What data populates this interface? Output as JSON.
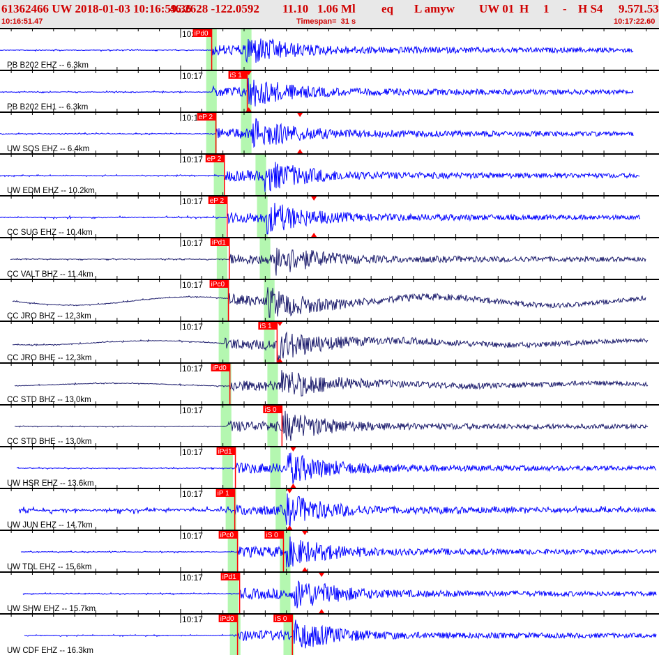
{
  "header": {
    "fields": [
      "61362466 UW 2018-01-03 10:16:59.36",
      "46.2628 -122.0592",
      "11.10",
      "1.06 Ml",
      "eq",
      "L amyw",
      "UW 01",
      "H",
      "1",
      "-",
      "H S4",
      "9.57",
      "1.53"
    ],
    "start_time": "10:16:51.47",
    "timespan": "Timespan=  31 s",
    "end_time": "10:17:22.60"
  },
  "timescale": {
    "total_seconds": 31.13,
    "minute_mark_s": 8.53,
    "minute_label": "10:17"
  },
  "colors": {
    "pick": "#ff0000",
    "band": "#b4f7b0",
    "blue": "#0000ff",
    "navy": "#1c1c6c",
    "header_text": "#d00000"
  },
  "traces": [
    {
      "label": "PB B202 EHZ -- 6.3km",
      "color": "blue",
      "span": [
        0,
        29.9
      ],
      "noise": 1,
      "picks": [
        {
          "label": "iPd0",
          "t": 10.0,
          "phase": "P"
        }
      ],
      "s_onset": 11.6,
      "bands": [
        9.74,
        11.38
      ],
      "amp_marker": null
    },
    {
      "label": "PB B202 EH1 -- 6.3km",
      "color": "blue",
      "span": [
        0,
        29.9
      ],
      "noise": 1,
      "picks": [
        {
          "label": "iS 1",
          "t": 11.68,
          "phase": "S"
        }
      ],
      "s_onset": 11.68,
      "bands": [
        9.74,
        11.38
      ],
      "amp_marker": 11.75
    },
    {
      "label": "UW SQS EHZ -- 6.4km",
      "color": "blue",
      "span": [
        0,
        29.9
      ],
      "noise": 1,
      "picks": [
        {
          "label": "eP 2",
          "t": 10.2,
          "phase": "P"
        }
      ],
      "s_onset": 11.9,
      "bands": [
        9.74,
        11.38
      ],
      "amp_marker": 14.17
    },
    {
      "label": "UW EDM EHZ -- 10.2km",
      "color": "blue",
      "span": [
        0,
        30.2
      ],
      "noise": 1,
      "picks": [
        {
          "label": "eP 2",
          "t": 10.6,
          "phase": "P"
        }
      ],
      "s_onset": 12.5,
      "bands": [
        10.1,
        12.07
      ],
      "amp_marker": null
    },
    {
      "label": "CC SUG EHZ -- 10.4km",
      "color": "blue",
      "span": [
        0,
        30.25
      ],
      "noise": 1.5,
      "picks": [
        {
          "label": "eP 2",
          "t": 10.73,
          "phase": "P"
        }
      ],
      "s_onset": 12.6,
      "bands": [
        10.17,
        12.14
      ],
      "amp_marker": 14.83
    },
    {
      "label": "CC VALT BHZ -- 11.4km",
      "color": "navy",
      "span": [
        0.5,
        30.5
      ],
      "noise": 1,
      "picks": [
        {
          "label": "iPd1",
          "t": 10.83,
          "phase": "P"
        }
      ],
      "s_onset": 13.0,
      "bands": [
        10.24,
        12.27
      ],
      "amp_marker": null
    },
    {
      "label": "CC JRO BHZ -- 12.3km",
      "color": "navy",
      "span": [
        0.6,
        30.5
      ],
      "noise": 1,
      "swell": 6,
      "picks": [
        {
          "label": "iPc0",
          "t": 10.79,
          "phase": "P"
        }
      ],
      "s_onset": 12.6,
      "bands": [
        10.33,
        12.47
      ],
      "amp_marker": null
    },
    {
      "label": "CC JRO BHE -- 12.3km",
      "color": "navy",
      "span": [
        0.6,
        30.6
      ],
      "noise": 1,
      "swell": 3,
      "picks": [
        {
          "label": "iS 1",
          "t": 13.09,
          "phase": "S"
        }
      ],
      "s_onset": 13.1,
      "bands": [
        10.33,
        12.47
      ],
      "amp_marker": 13.22
    },
    {
      "label": "CC STD BHZ -- 13.0km",
      "color": "navy",
      "span": [
        0.7,
        30.6
      ],
      "noise": 1,
      "swell": 2,
      "picks": [
        {
          "label": "iPd0",
          "t": 10.86,
          "phase": "P"
        }
      ],
      "s_onset": 13.3,
      "bands": [
        10.43,
        12.63
      ],
      "amp_marker": null
    },
    {
      "label": "CC STD BHE -- 13.0km",
      "color": "navy",
      "span": [
        0.7,
        30.6
      ],
      "noise": 0.7,
      "picks": [
        {
          "label": "iS 0",
          "t": 13.32,
          "phase": "S"
        }
      ],
      "s_onset": 13.32,
      "bands": [
        10.43,
        12.63
      ],
      "amp_marker": null
    },
    {
      "label": "UW HSR EHZ -- 13.6km",
      "color": "blue",
      "span": [
        0.8,
        31.0
      ],
      "noise": 1,
      "picks": [
        {
          "label": "iPd1",
          "t": 11.12,
          "phase": "P"
        }
      ],
      "s_onset": 13.6,
      "bands": [
        10.5,
        12.76
      ],
      "amp_marker": 13.85
    },
    {
      "label": "UW JUN EHZ -- 14.7km",
      "color": "blue",
      "span": [
        0.9,
        31.0
      ],
      "noise": 4,
      "picks": [
        {
          "label": "iP 1",
          "t": 11.09,
          "phase": "P"
        }
      ],
      "s_onset": 13.5,
      "bands": [
        10.66,
        13.02
      ],
      "amp_marker": 13.68
    },
    {
      "label": "UW TDL EHZ -- 15.6km",
      "color": "blue",
      "span": [
        1.0,
        31.0
      ],
      "noise": 1,
      "picks": [
        {
          "label": "iPc0",
          "t": 11.22,
          "phase": "P"
        },
        {
          "label": "iS 0",
          "t": 13.39,
          "phase": "S"
        }
      ],
      "s_onset": 13.39,
      "bands": [
        10.76,
        13.22
      ],
      "amp_marker": 14.4
    },
    {
      "label": "UW SHW EHZ -- 15.7km",
      "color": "blue",
      "span": [
        1.1,
        31.0
      ],
      "noise": 1,
      "picks": [
        {
          "label": "iPd1",
          "t": 11.32,
          "phase": "P"
        }
      ],
      "s_onset": 13.9,
      "bands": [
        10.76,
        13.22
      ],
      "amp_marker": 15.19
    },
    {
      "label": "UW CDF EHZ -- 16.3km",
      "color": "blue",
      "span": [
        1.15,
        31.0
      ],
      "noise": 1,
      "picks": [
        {
          "label": "iPd0",
          "t": 11.22,
          "phase": "P"
        },
        {
          "label": "iS 0",
          "t": 13.81,
          "phase": "S"
        }
      ],
      "s_onset": 13.81,
      "bands": [
        10.86,
        13.39
      ],
      "amp_marker": null
    }
  ]
}
